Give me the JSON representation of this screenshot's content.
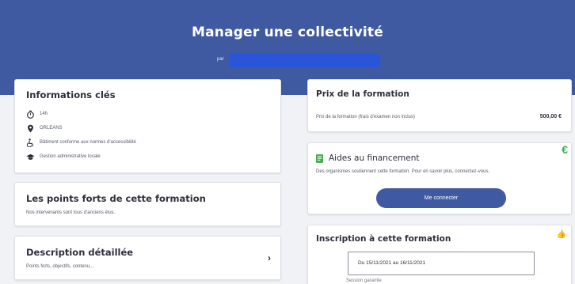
{
  "header": {
    "title": "Manager une collectivité",
    "by_label": "par",
    "author_redacted": ""
  },
  "key_info": {
    "title": "Informations clés",
    "items": [
      {
        "icon": "stopwatch-icon",
        "text": "14h"
      },
      {
        "icon": "location-pin-icon",
        "text": "ORLEANS"
      },
      {
        "icon": "accessibility-icon",
        "text": "Bâtiment conforme aux normes d'accessibilité"
      },
      {
        "icon": "graduation-cap-icon",
        "text": "Gestion administrative locale"
      }
    ]
  },
  "strengths": {
    "title": "Les points forts de cette formation",
    "text": "Nos intervenants sont tous d'anciens élus."
  },
  "description": {
    "title": "Description détaillée",
    "text": "Points forts, objectifs, contenu,...",
    "chevron": "›"
  },
  "price": {
    "title": "Prix de la formation",
    "label": "Prix de la formation (frais d'examen non inclus)",
    "value": "500,00 €"
  },
  "funding": {
    "title": "Aides au financement",
    "text": "Des organismes soutiennent cette formation. Pour en savoir plus, connectez-vous.",
    "button": "Me connecter",
    "badge": "€"
  },
  "registration": {
    "title": "Inscription à cette formation",
    "session_value": "Du 15/11/2021 au 16/11/2021",
    "note": "Session garantie"
  },
  "colors": {
    "header_bg": "#3f5aa0",
    "accent_green": "#3fae4a",
    "button_bg": "#3f5aa0"
  }
}
